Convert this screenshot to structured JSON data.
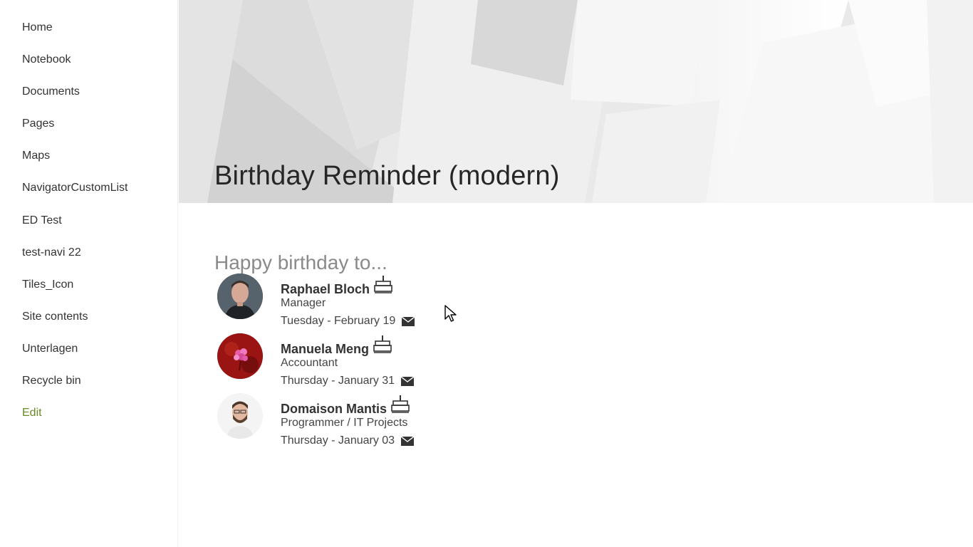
{
  "sidebar": {
    "items": [
      {
        "label": "Home"
      },
      {
        "label": "Notebook"
      },
      {
        "label": "Documents"
      },
      {
        "label": "Pages"
      },
      {
        "label": "Maps"
      },
      {
        "label": "NavigatorCustomList"
      },
      {
        "label": "ED Test"
      },
      {
        "label": "test-navi 22"
      },
      {
        "label": "Tiles_Icon"
      },
      {
        "label": "Site contents"
      },
      {
        "label": "Unterlagen"
      },
      {
        "label": "Recycle bin"
      }
    ],
    "edit_label": "Edit",
    "edit_color": "#6a8a2a"
  },
  "header": {
    "title": "Birthday Reminder (modern)"
  },
  "birthdays": {
    "heading": "Happy birthday to...",
    "people": [
      {
        "name": "Raphael Bloch",
        "role": "Manager",
        "date": "Tuesday - February 19",
        "avatar": "man-portrait-avatar"
      },
      {
        "name": "Manuela Meng",
        "role": "Accountant",
        "date": "Thursday - January 31",
        "avatar": "pink-flower-avatar"
      },
      {
        "name": "Domaison Mantis",
        "role": "Programmer / IT Projects",
        "date": "Thursday - January 03",
        "avatar": "bearded-man-avatar"
      }
    ]
  },
  "icons": {
    "cake": "birthday-cake-icon",
    "mail": "mail-icon",
    "cursor": "mouse-pointer-icon"
  }
}
